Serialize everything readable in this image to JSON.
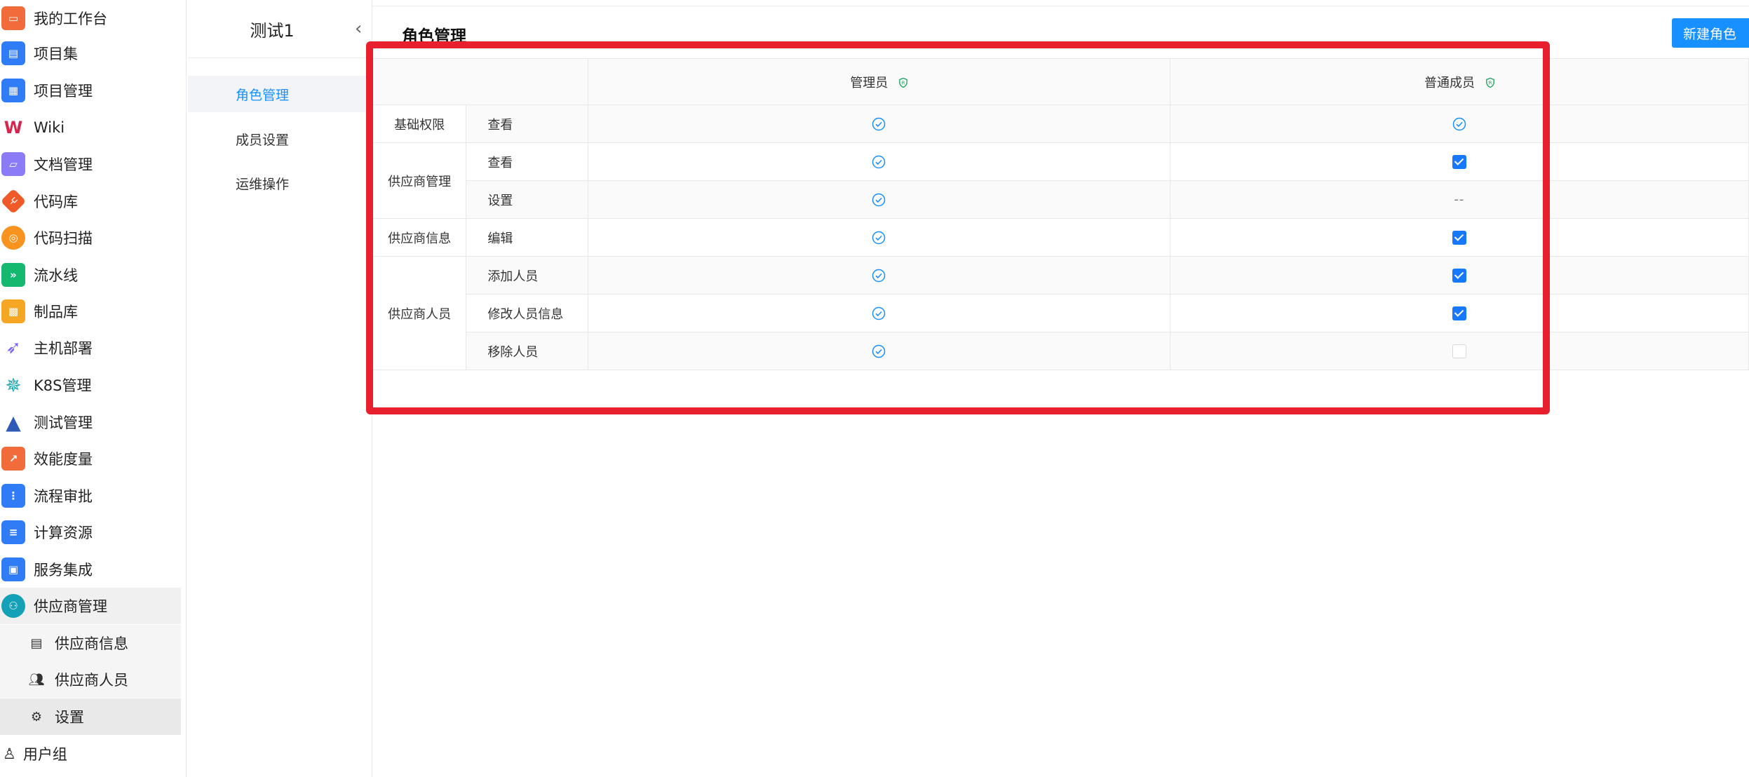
{
  "nav": {
    "items": [
      {
        "label": "我的工作台",
        "icon": "workbench-icon",
        "color": "#f26b3a"
      },
      {
        "label": "项目集",
        "icon": "project-set-icon",
        "color": "#2f7cf6"
      },
      {
        "label": "项目管理",
        "icon": "project-management-icon",
        "color": "#2f7cf6"
      },
      {
        "label": "Wiki",
        "icon": "wiki-icon",
        "color": "#d9254e"
      },
      {
        "label": "文档管理",
        "icon": "document-icon",
        "color": "#8b7cf6"
      },
      {
        "label": "代码库",
        "icon": "code-repo-icon",
        "color": "#f05a28"
      },
      {
        "label": "代码扫描",
        "icon": "code-scan-icon",
        "color": "#f7931e"
      },
      {
        "label": "流水线",
        "icon": "pipeline-icon",
        "color": "#14b86e"
      },
      {
        "label": "制品库",
        "icon": "artifact-icon",
        "color": "#f5a623"
      },
      {
        "label": "主机部署",
        "icon": "rocket-icon",
        "color": "#7b61ff"
      },
      {
        "label": "K8S管理",
        "icon": "kubernetes-icon",
        "color": "#1aa6b7"
      },
      {
        "label": "测试管理",
        "icon": "flask-icon",
        "color": "#2f5bb7"
      },
      {
        "label": "效能度量",
        "icon": "metrics-icon",
        "color": "#f26b3a"
      },
      {
        "label": "流程审批",
        "icon": "approval-icon",
        "color": "#2f7cf6"
      },
      {
        "label": "计算资源",
        "icon": "compute-icon",
        "color": "#2f7cf6"
      },
      {
        "label": "服务集成",
        "icon": "chip-icon",
        "color": "#2f7cf6"
      },
      {
        "label": "供应商管理",
        "icon": "supplier-icon",
        "color": "#14a0b7"
      }
    ],
    "sub_items": [
      {
        "label": "供应商信息",
        "icon": "id-card-icon"
      },
      {
        "label": "供应商人员",
        "icon": "people-icon"
      },
      {
        "label": "设置",
        "icon": "gear-icon"
      }
    ],
    "user_group": {
      "label": "用户组",
      "icon": "user-icon"
    }
  },
  "subpanel": {
    "title": "测试1",
    "items": [
      "角色管理",
      "成员设置",
      "运维操作"
    ]
  },
  "main": {
    "title": "角色管理",
    "new_role_button": "新建角色",
    "columns": [
      "管理员",
      "普通成员"
    ],
    "groups": {
      "basic": "基础权限",
      "supplier_mgmt": "供应商管理",
      "supplier_info": "供应商信息",
      "supplier_staff": "供应商人员"
    },
    "perms": {
      "view1": "查看",
      "view2": "查看",
      "settings": "设置",
      "edit": "编辑",
      "add_staff": "添加人员",
      "modify_staff": "修改人员信息",
      "remove_staff": "移除人员"
    },
    "member_values": {
      "view1": "circle",
      "view2": "checked",
      "settings": "--",
      "edit": "checked",
      "add_staff": "checked",
      "modify_staff": "checked",
      "remove_staff": "unchecked"
    },
    "colors": {
      "accent": "#1890ff",
      "highlight": "#e8202e",
      "shield": "#19a35b"
    }
  }
}
